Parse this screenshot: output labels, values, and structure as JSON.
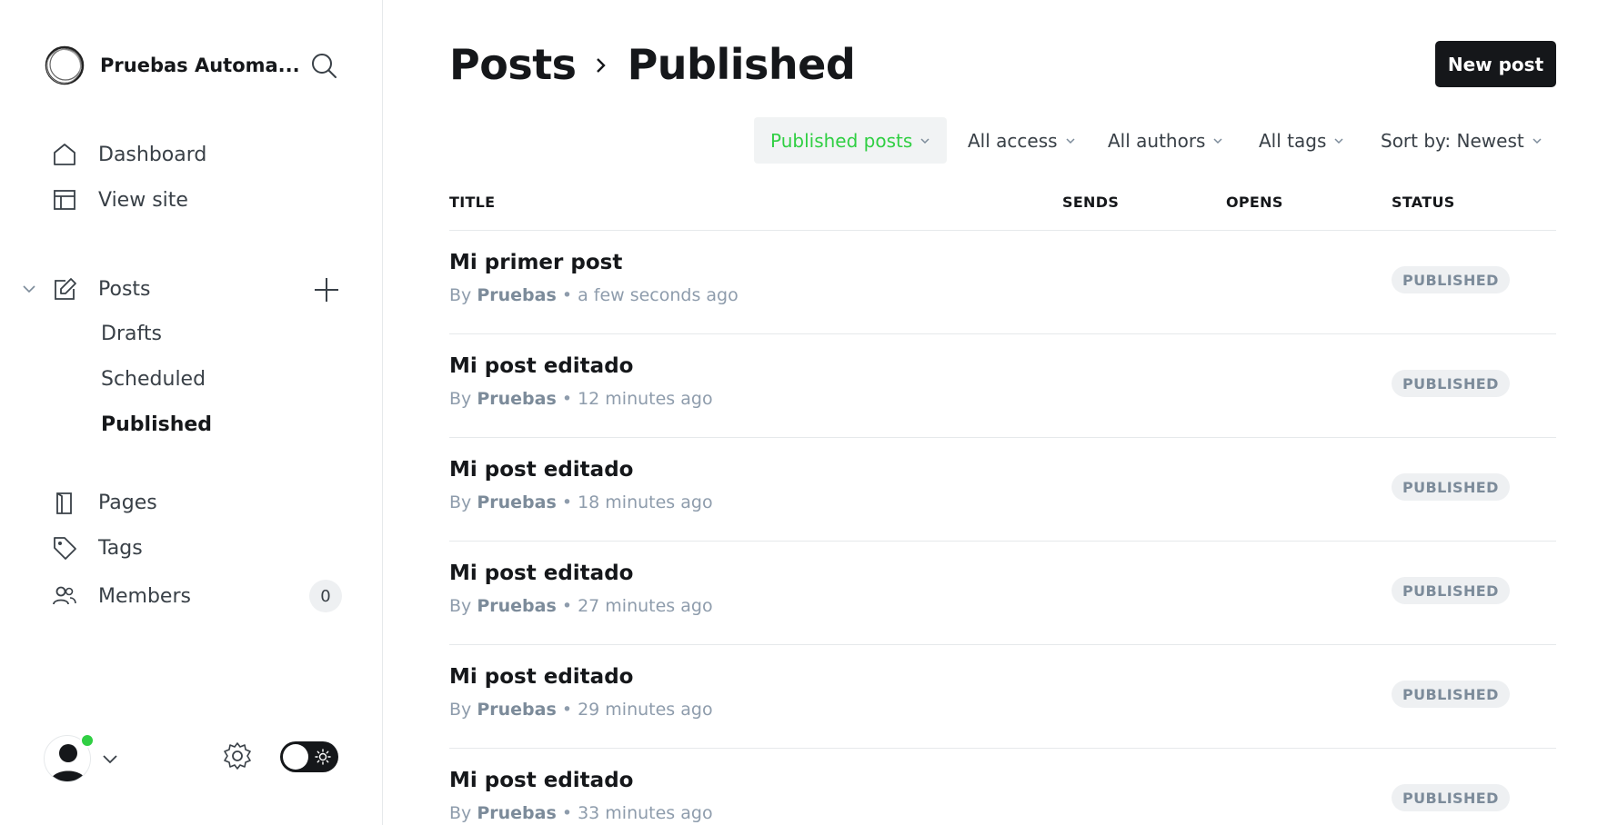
{
  "sidebar": {
    "brand_name": "Pruebas Automa...",
    "nav": {
      "dashboard": "Dashboard",
      "view_site": "View site",
      "posts": "Posts",
      "drafts": "Drafts",
      "scheduled": "Scheduled",
      "published": "Published",
      "pages": "Pages",
      "tags": "Tags",
      "members": "Members",
      "members_count": "0"
    }
  },
  "header": {
    "crumb_root": "Posts",
    "crumb_current": "Published",
    "new_post": "New post"
  },
  "filters": {
    "type": "Published posts",
    "access": "All access",
    "authors": "All authors",
    "tags": "All tags",
    "sort": "Sort by: Newest"
  },
  "table": {
    "columns": {
      "title": "TITLE",
      "sends": "SENDS",
      "opens": "OPENS",
      "status": "STATUS"
    },
    "rows": [
      {
        "title": "Mi primer post",
        "by": "By",
        "author": "Pruebas",
        "time": "• a few seconds ago",
        "status": "PUBLISHED"
      },
      {
        "title": "Mi post editado",
        "by": "By",
        "author": "Pruebas",
        "time": "• 12 minutes ago",
        "status": "PUBLISHED"
      },
      {
        "title": "Mi post editado",
        "by": "By",
        "author": "Pruebas",
        "time": "• 18 minutes ago",
        "status": "PUBLISHED"
      },
      {
        "title": "Mi post editado",
        "by": "By",
        "author": "Pruebas",
        "time": "• 27 minutes ago",
        "status": "PUBLISHED"
      },
      {
        "title": "Mi post editado",
        "by": "By",
        "author": "Pruebas",
        "time": "• 29 minutes ago",
        "status": "PUBLISHED"
      },
      {
        "title": "Mi post editado",
        "by": "By",
        "author": "Pruebas",
        "time": "• 33 minutes ago",
        "status": "PUBLISHED"
      }
    ]
  },
  "colors": {
    "accent_green": "#30cf43",
    "dark": "#15171a",
    "muted": "#8e9cac",
    "divider": "#e6e9eb"
  }
}
